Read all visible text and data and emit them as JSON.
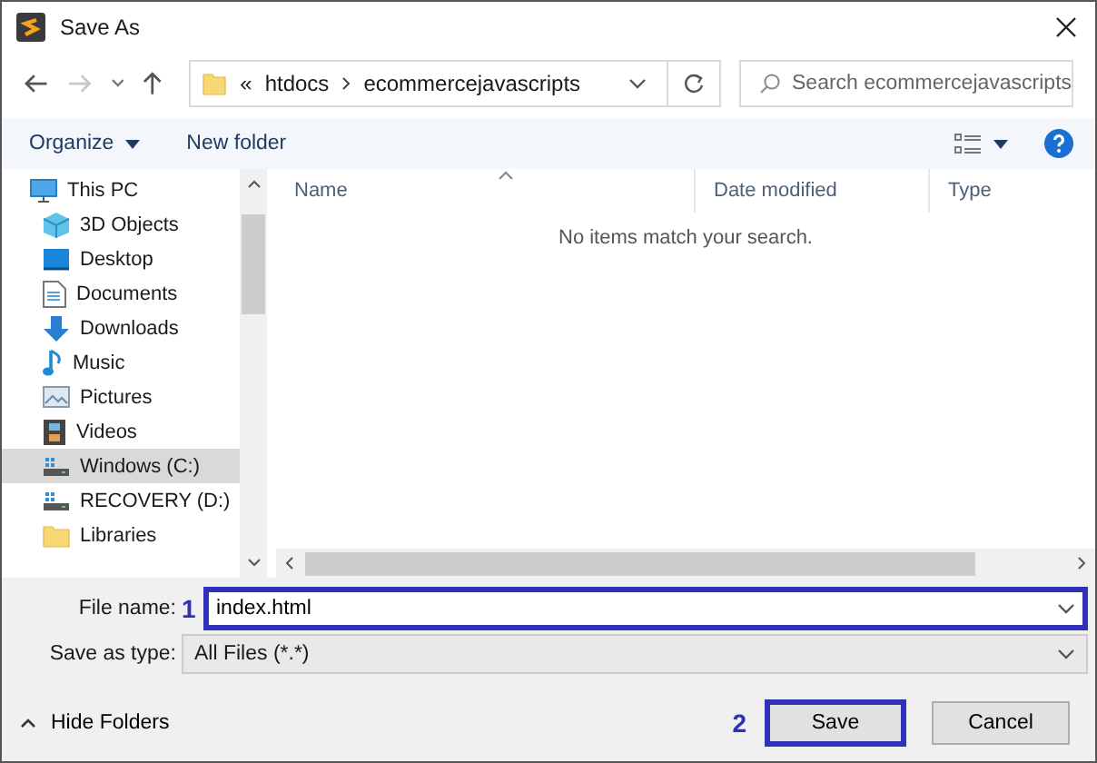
{
  "window": {
    "title": "Save As"
  },
  "nav": {
    "back_disabled": false,
    "forward_disabled": true,
    "breadcrumb": [
      "«",
      "htdocs",
      "ecommercejavascripts"
    ],
    "search": {
      "placeholder": "Search ecommercejavascripts"
    }
  },
  "toolbar": {
    "organize": "Organize",
    "new_folder": "New folder"
  },
  "sidebar": {
    "items": [
      {
        "label": "This PC",
        "kind": "pc",
        "selected": false
      },
      {
        "label": "3D Objects",
        "kind": "cube",
        "selected": false
      },
      {
        "label": "Desktop",
        "kind": "desktop",
        "selected": false
      },
      {
        "label": "Documents",
        "kind": "document",
        "selected": false
      },
      {
        "label": "Downloads",
        "kind": "download",
        "selected": false
      },
      {
        "label": "Music",
        "kind": "music",
        "selected": false
      },
      {
        "label": "Pictures",
        "kind": "picture",
        "selected": false
      },
      {
        "label": "Videos",
        "kind": "video",
        "selected": false
      },
      {
        "label": "Windows (C:)",
        "kind": "drive",
        "selected": true
      },
      {
        "label": "RECOVERY (D:)",
        "kind": "drive",
        "selected": false
      },
      {
        "label": "Libraries",
        "kind": "folder",
        "selected": false
      }
    ]
  },
  "table": {
    "columns": [
      "Name",
      "Date modified",
      "Type"
    ],
    "empty_message": "No items match your search."
  },
  "form": {
    "file_name": {
      "label": "File name:",
      "value": "index.html",
      "highlighted": true,
      "callout": "1"
    },
    "save_as_type": {
      "label": "Save as type:",
      "value": "All Files (*.*)"
    }
  },
  "footer": {
    "hide_folders": "Hide Folders",
    "buttons": [
      {
        "label": "Save",
        "highlighted": true,
        "callout": "2"
      },
      {
        "label": "Cancel",
        "highlighted": false
      }
    ]
  }
}
